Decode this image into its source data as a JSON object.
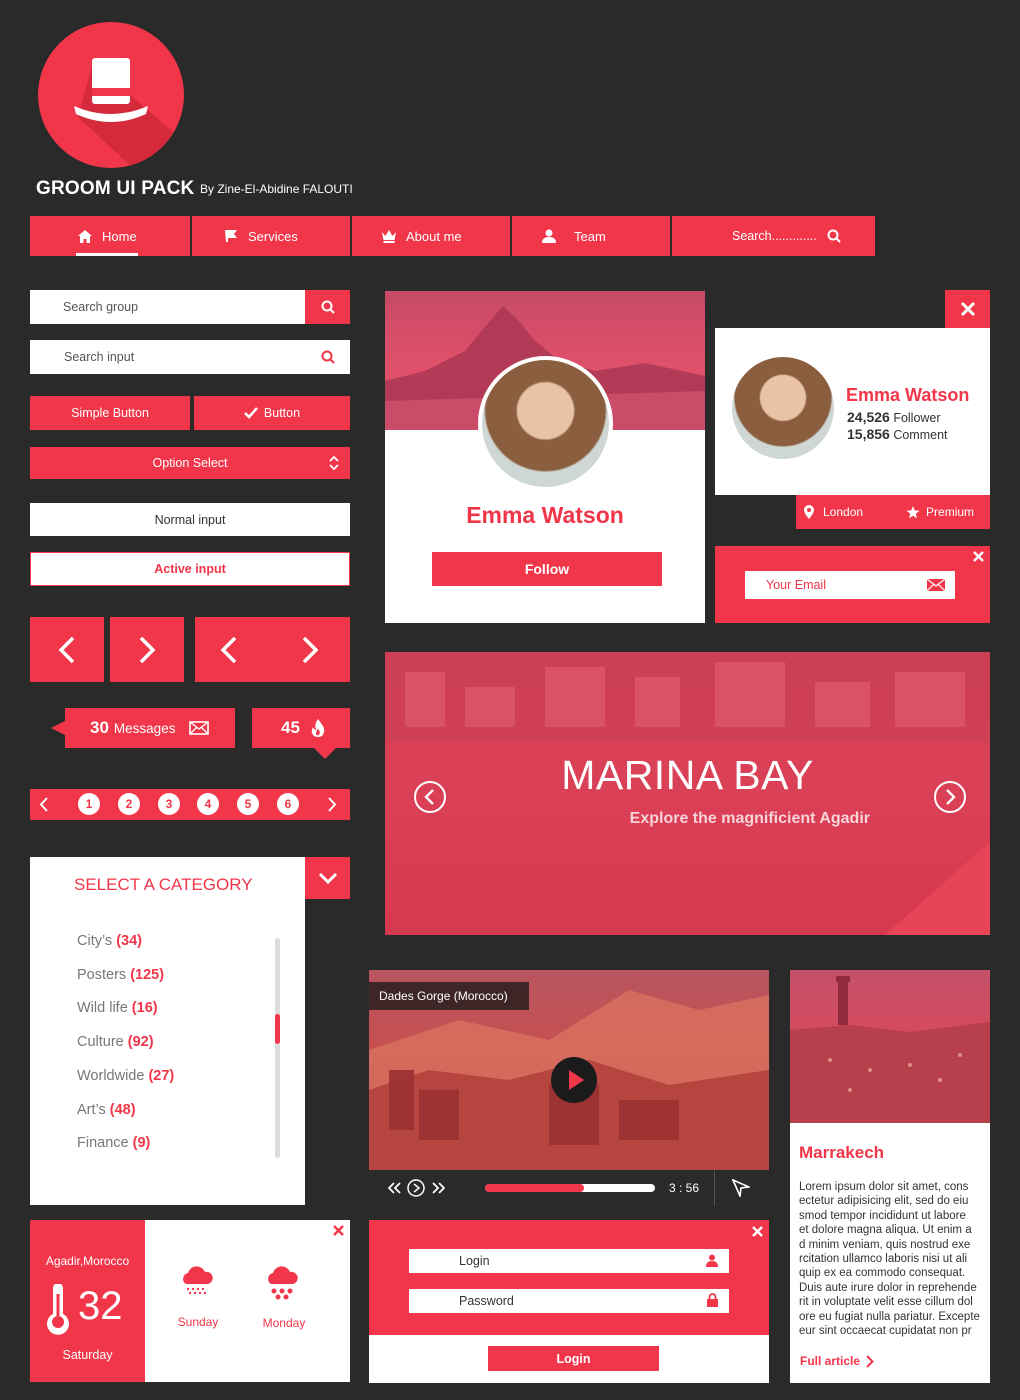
{
  "brand": {
    "title": "GROOM UI PACK",
    "author": "By Zine-El-Abidine FALOUTI"
  },
  "colors": {
    "accent": "#f2364a",
    "background": "#2a2a2a"
  },
  "nav": {
    "items": [
      {
        "label": "Home",
        "icon": "home-icon"
      },
      {
        "label": "Services",
        "icon": "flag-icon"
      },
      {
        "label": "About me",
        "icon": "crown-icon"
      },
      {
        "label": "Team",
        "icon": "user-icon"
      }
    ],
    "search_placeholder": "Search............."
  },
  "forms": {
    "search_group_placeholder": "Search group",
    "search_input_placeholder": "Search input",
    "simple_button": "Simple Button",
    "check_button": "Button",
    "option_select": "Option Select",
    "normal_input": "Normal input",
    "active_input": "Active input"
  },
  "badges": {
    "messages_count": "30",
    "messages_label": "Messages",
    "fire_count": "45"
  },
  "pagination": {
    "pages": [
      "1",
      "2",
      "3",
      "4",
      "5",
      "6"
    ]
  },
  "category": {
    "title": "SELECT A CATEGORY",
    "items": [
      {
        "name": "City’s",
        "count": "(34)"
      },
      {
        "name": "Posters",
        "count": "(125)"
      },
      {
        "name": "Wild life",
        "count": "(16)"
      },
      {
        "name": "Culture",
        "count": "(92)"
      },
      {
        "name": "Worldwide",
        "count": "(27)"
      },
      {
        "name": "Art’s",
        "count": "(48)"
      },
      {
        "name": "Finance",
        "count": "(9)"
      }
    ]
  },
  "profile_card": {
    "name": "Emma Watson",
    "follow_label": "Follow"
  },
  "profile_small": {
    "name": "Emma Watson",
    "followers": "24,526",
    "followers_label": "Follower",
    "comments": "15,856",
    "comments_label": "Comment",
    "location": "London",
    "tier": "Premium"
  },
  "newsletter": {
    "email_placeholder": "Your Email"
  },
  "slider": {
    "title": "MARINA BAY",
    "subtitle": "Explore the magnificient Agadir"
  },
  "video": {
    "title": "Dades Gorge (Morocco)",
    "time": "3 : 56",
    "progress": 0.58
  },
  "article": {
    "title": "Marrakech",
    "body": [
      "Lorem ipsum dolor sit amet, cons",
      "ectetur adipisicing elit, sed do eiu",
      "smod tempor incididunt ut labore",
      "et dolore magna aliqua. Ut enim a",
      "d minim veniam, quis nostrud exe",
      "rcitation ullamco laboris nisi ut ali",
      "quip ex ea commodo consequat.",
      "Duis aute irure dolor in reprehende",
      "rit in voluptate velit esse cillum dol",
      "ore eu fugiat nulla pariatur. Excepte",
      "eur sint occaecat cupidatat non pr"
    ],
    "link": "Full article"
  },
  "weather": {
    "city": "Agadir,Morocco",
    "temp": "32",
    "today": "Saturday",
    "days": [
      "Sunday",
      "Monday"
    ]
  },
  "login": {
    "login_placeholder": "Login",
    "password_placeholder": "Password",
    "button": "Login"
  }
}
